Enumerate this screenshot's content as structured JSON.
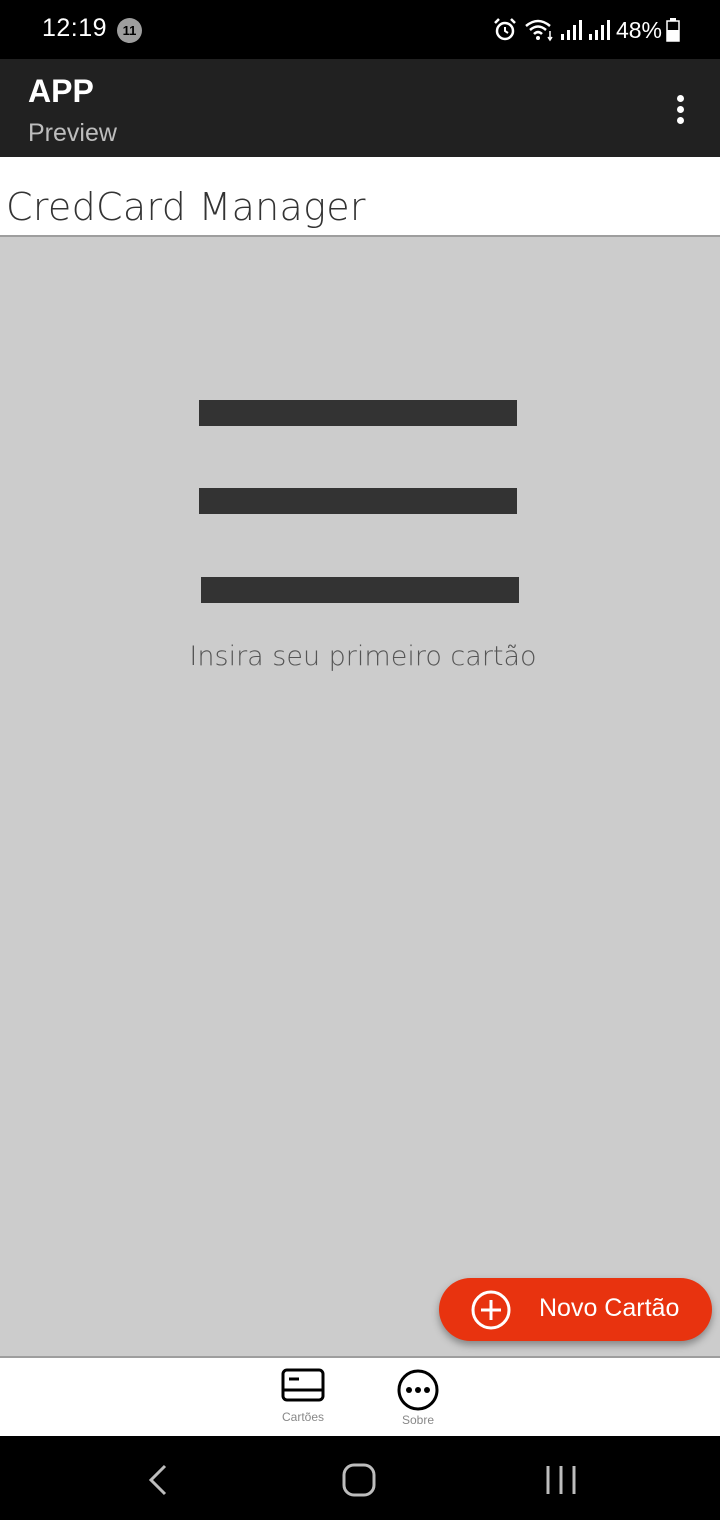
{
  "status_bar": {
    "time": "12:19",
    "notification_count": "11",
    "battery": "48%",
    "icons": [
      "alarm-icon",
      "wifi-icon",
      "signal-icon",
      "signal-icon",
      "battery-icon"
    ]
  },
  "app_bar": {
    "title": "APP",
    "subtitle": "Preview",
    "menu_icon": "more-vert-icon"
  },
  "header": {
    "title": "CredCard Manager"
  },
  "main": {
    "empty_icon": "menu-lines-icon",
    "empty_message": "Insira seu primeiro cartão"
  },
  "fab": {
    "label": "Novo Cartão",
    "icon": "add-circle-icon"
  },
  "bottom_nav": {
    "items": [
      {
        "label": "Cartões",
        "icon": "credit-card-icon"
      },
      {
        "label": "Sobre",
        "icon": "more-horiz-icon"
      }
    ]
  },
  "system_nav": {
    "buttons": [
      "back-icon",
      "home-icon",
      "recents-icon"
    ]
  },
  "colors": {
    "status_bar": "#000000",
    "app_bar": "#212121",
    "background": "#cccccc",
    "accent": "#e8330f",
    "dark_gray": "#333333"
  }
}
